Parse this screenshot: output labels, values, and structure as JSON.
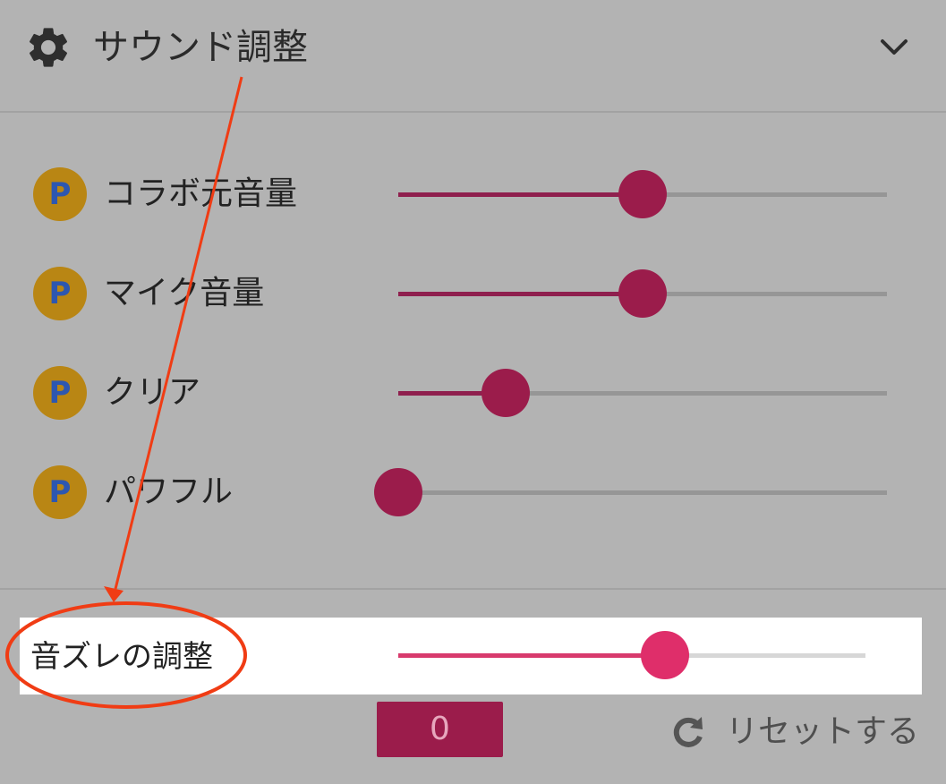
{
  "header": {
    "icon": "gear-icon",
    "title": "サウンド調整",
    "toggle_icon": "chevron-down-icon"
  },
  "sliders": [
    {
      "badge": "P",
      "label": "コラボ元音量",
      "level_pct": 50
    },
    {
      "badge": "P",
      "label": "マイク音量",
      "level_pct": 50
    },
    {
      "badge": "P",
      "label": "クリア",
      "level_pct": 22
    },
    {
      "badge": "P",
      "label": "パワフル",
      "level_pct": 0
    }
  ],
  "sync": {
    "label": "音ズレの調整",
    "level_pct": 57,
    "value": "0"
  },
  "reset": {
    "icon": "refresh-icon",
    "label": "リセットする"
  },
  "colors": {
    "background": "#b3b3b3",
    "accent": "#9b1c4b",
    "accent_highlight": "#df2e6a",
    "badge": "#b98614",
    "annotation": "#f03c14"
  }
}
